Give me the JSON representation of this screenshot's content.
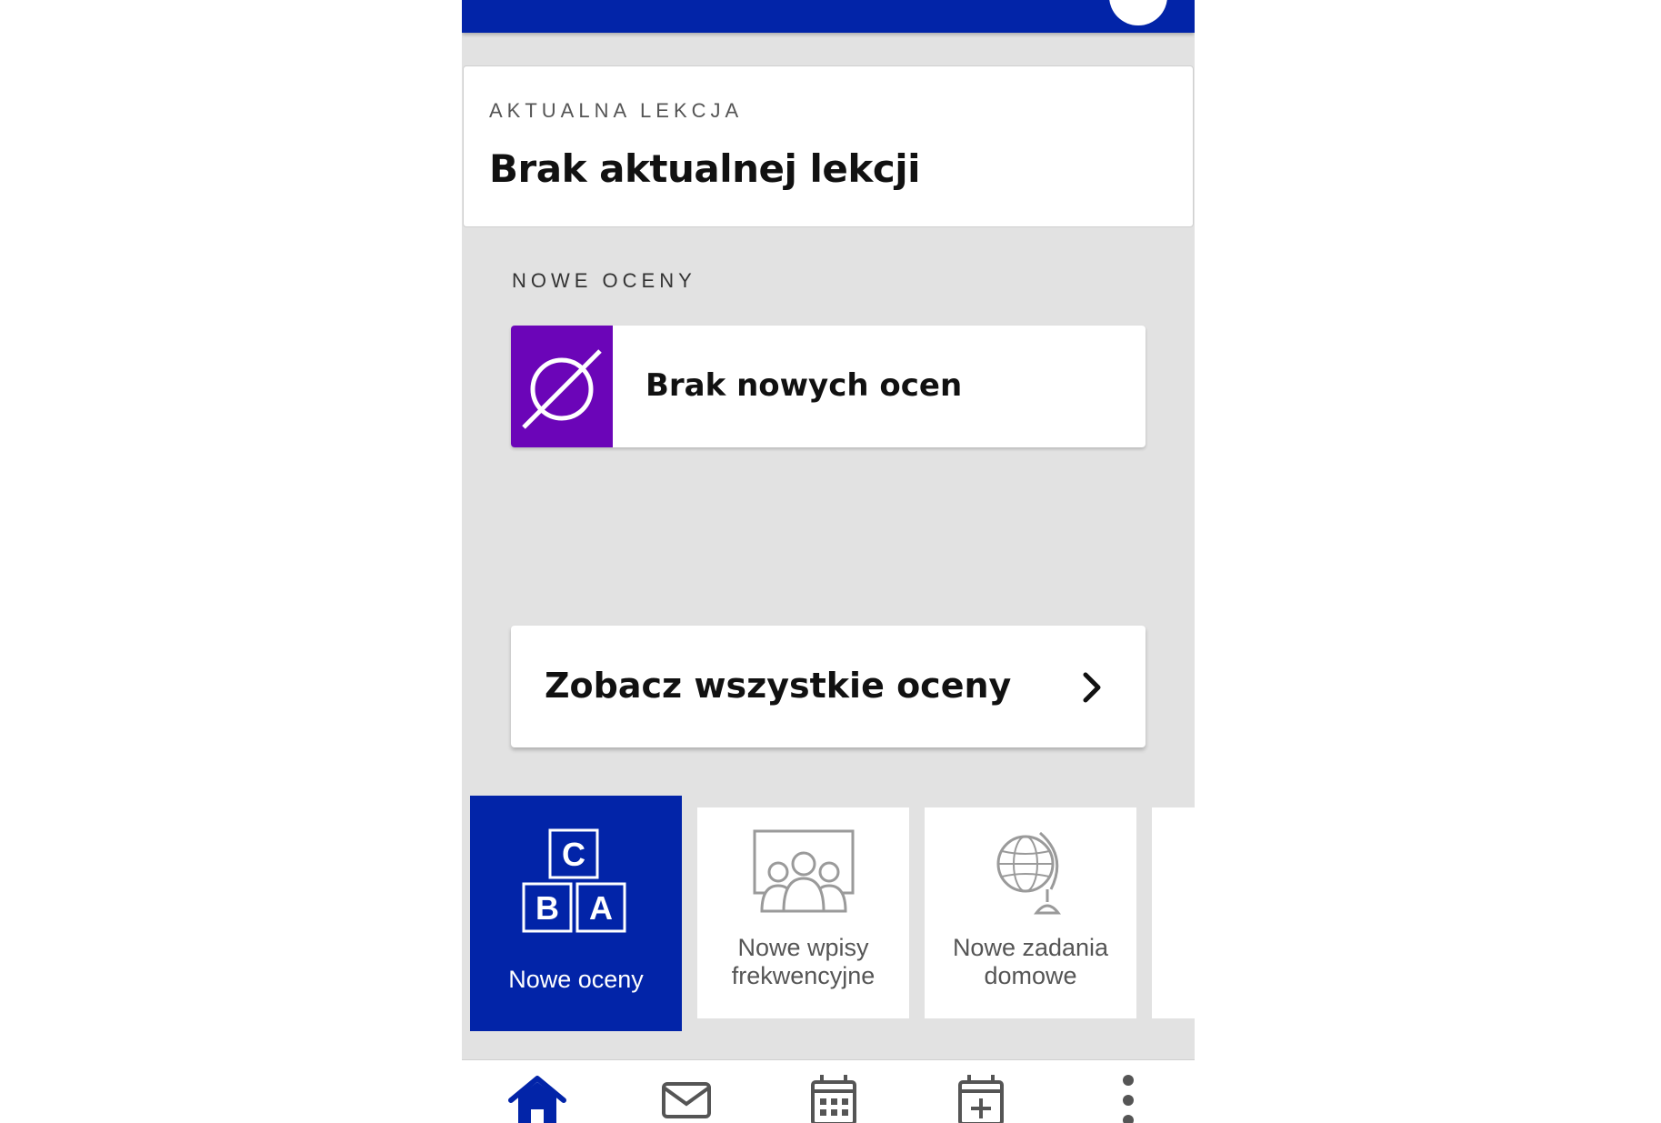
{
  "current_lesson": {
    "overline": "AKTUALNA LEKCJA",
    "title": "Brak aktualnej lekcji"
  },
  "new_grades": {
    "section_label": "NOWE OCENY",
    "empty_text": "Brak nowych ocen",
    "icon": "empty-set-icon",
    "icon_color": "#6b05b8"
  },
  "all_grades_button": {
    "label": "Zobacz wszystkie oceny",
    "icon": "chevron-right-icon"
  },
  "tiles": [
    {
      "label": "Nowe oceny",
      "icon": "abc-blocks-icon",
      "active": true
    },
    {
      "label_line1": "Nowe wpisy",
      "label_line2": "frekwencyjne",
      "icon": "classroom-icon",
      "active": false
    },
    {
      "label_line1": "Nowe zadania",
      "label_line2": "domowe",
      "icon": "globe-icon",
      "active": false
    }
  ],
  "bottom_nav": [
    {
      "name": "home",
      "icon": "home-icon",
      "active": true
    },
    {
      "name": "messages",
      "icon": "mail-icon",
      "active": false
    },
    {
      "name": "timetable",
      "icon": "calendar-grid-icon",
      "active": false
    },
    {
      "name": "events",
      "icon": "calendar-add-icon",
      "active": false
    },
    {
      "name": "more",
      "icon": "more-vertical-icon",
      "active": false
    }
  ],
  "colors": {
    "primary": "#0224a8",
    "accent_purple": "#6b05b8",
    "background": "#e2e2e2"
  }
}
